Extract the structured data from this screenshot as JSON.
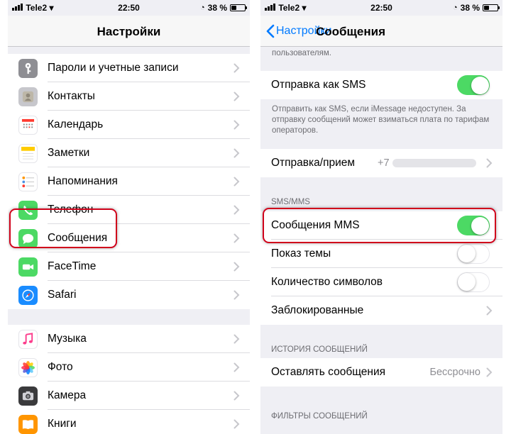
{
  "left": {
    "status": {
      "carrier": "Tele2",
      "time": "22:50",
      "battery": "38 %",
      "battery_level": 0.38
    },
    "title": "Настройки",
    "group1": [
      {
        "label": "Пароли и учетные записи",
        "icon": "key-icon",
        "color": "#8e8e93"
      },
      {
        "label": "Контакты",
        "icon": "contacts-icon",
        "color": "#c7c7cc"
      },
      {
        "label": "Календарь",
        "icon": "calendar-icon",
        "color": "#ffffff"
      },
      {
        "label": "Заметки",
        "icon": "notes-icon",
        "color": "#ffffff"
      },
      {
        "label": "Напоминания",
        "icon": "reminders-icon",
        "color": "#ffffff"
      },
      {
        "label": "Телефон",
        "icon": "phone-icon",
        "color": "#4cd964"
      },
      {
        "label": "Сообщения",
        "icon": "messages-icon",
        "color": "#4cd964"
      },
      {
        "label": "FaceTime",
        "icon": "facetime-icon",
        "color": "#4cd964"
      },
      {
        "label": "Safari",
        "icon": "safari-icon",
        "color": "#1a8cff"
      }
    ],
    "group2": [
      {
        "label": "Музыка",
        "icon": "music-icon",
        "color": "#ffffff"
      },
      {
        "label": "Фото",
        "icon": "photos-icon",
        "color": "#ffffff"
      },
      {
        "label": "Камера",
        "icon": "camera-icon",
        "color": "#3a3a3c"
      },
      {
        "label": "Книги",
        "icon": "books-icon",
        "color": "#ff9500"
      }
    ]
  },
  "right": {
    "status": {
      "carrier": "Tele2",
      "time": "22:50",
      "battery": "38 %",
      "battery_level": 0.38
    },
    "back_label": "Настройки",
    "title": "Сообщения",
    "top_note": "пользователям.",
    "send_as_sms": {
      "label": "Отправка как SMS",
      "on": true
    },
    "sms_note": "Отправить как SMS, если iMessage недоступен. За отправку сообщений может взиматься плата по тарифам операторов.",
    "send_receive": {
      "label": "Отправка/прием",
      "value": "+7"
    },
    "sms_mms_header": "SMS/MMS",
    "mms": {
      "label": "Сообщения MMS",
      "on": true
    },
    "show_subject": {
      "label": "Показ темы",
      "on": false
    },
    "char_count": {
      "label": "Количество символов",
      "on": false
    },
    "blocked": {
      "label": "Заблокированные"
    },
    "history_header": "ИСТОРИЯ СООБЩЕНИЙ",
    "keep_messages": {
      "label": "Оставлять сообщения",
      "value": "Бессрочно"
    },
    "filters_header": "ФИЛЬТРЫ СООБЩЕНИЙ"
  },
  "colors": {
    "accent": "#007aff",
    "toggle_on": "#4cd964",
    "highlight": "#d0021b"
  }
}
